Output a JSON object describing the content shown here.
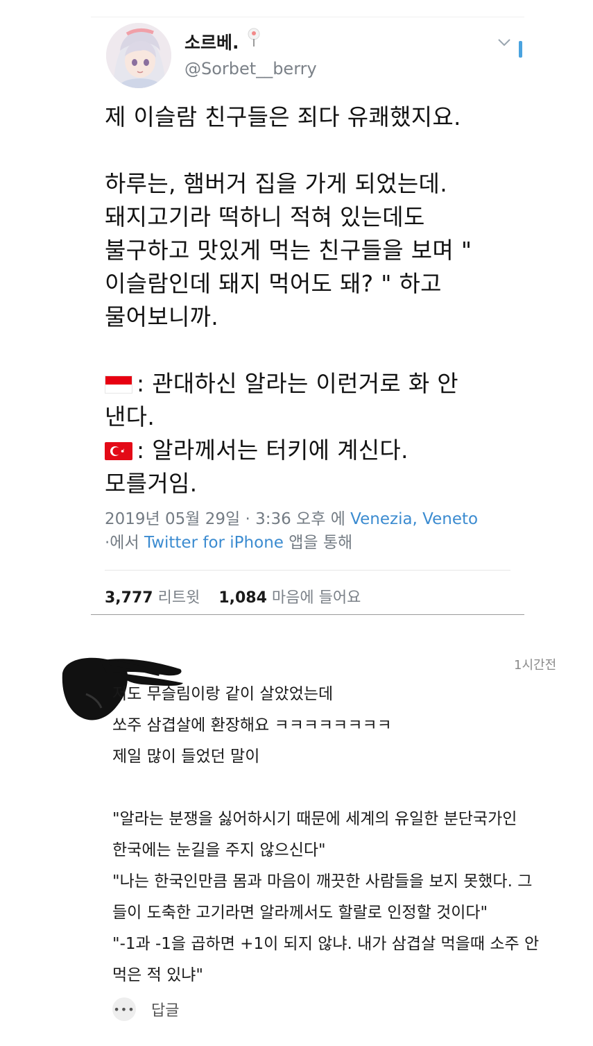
{
  "tweet": {
    "display_name": "소르베.",
    "handle": "@Sorbet__berry",
    "lines": [
      "제 이슬람 친구들은 죄다 유쾌했지요.",
      "",
      " 하루는, 햄버거 집을 가게 되었는데.",
      "돼지고기라 떡하니 적혀 있는데도",
      "불구하고 맛있게 먹는 친구들을 보며 \"",
      "이슬람인데 돼지 먹어도 돼? \" 하고",
      "물어보니까.",
      ""
    ],
    "flag_lines": [
      {
        "flag": "indonesia-flag-icon",
        "text": ": 관대하신 알라는 이런거로 화 안"
      },
      {
        "flag": "",
        "text": "낸다."
      },
      {
        "flag": "turkey-flag-icon",
        "text": ": 알라께서는 터키에 계신다."
      },
      {
        "flag": "",
        "text": "모를거임."
      }
    ],
    "meta": {
      "date": "2019년 05월 29일 · 3:36 오후 에 ",
      "location": "Venezia, Veneto",
      "via_prefix": "·에서 ",
      "client": "Twitter for iPhone",
      "via_suffix": " 앱을 통해"
    },
    "stats": {
      "retweets": "3,777",
      "retweets_label": "리트윗",
      "likes": "1,084",
      "likes_label": "마음에 들어요"
    }
  },
  "comment": {
    "time_ago": "1시간전",
    "lines": [
      "저도 무슬림이랑 같이 살았었는데",
      "쏘주 삼겹살에 환장해요 ㅋㅋㅋㅋㅋㅋㅋㅋ",
      "제일 많이 들었던 말이",
      "",
      "\"알라는 분쟁을 싫어하시기 때문에 세계의 유일한 분단국가인",
      "한국에는 눈길을 주지 않으신다\"",
      "\"나는 한국인만큼 몸과 마음이 깨끗한 사람들을 보지 못했다. 그",
      "들이 도축한 고기라면 알라께서도 할랄로 인정할 것이다\"",
      "\"-1과 -1을 곱하면 +1이 되지 않냐. 내가 삼겹살 먹을때 소주 안",
      "먹은 적 있냐\""
    ],
    "more_icon": "•••",
    "reply_label": "답글"
  },
  "colors": {
    "link": "#3b8bd0",
    "muted": "#737b83",
    "accent_bar": "#4aa3df"
  }
}
